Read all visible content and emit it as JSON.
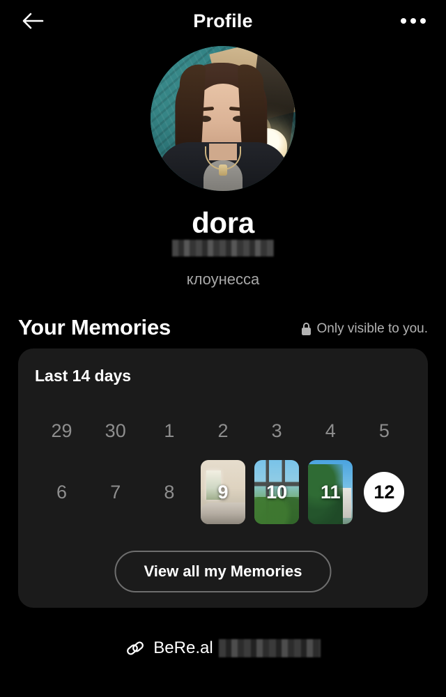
{
  "header": {
    "title": "Profile",
    "back_icon": "arrow-left-icon",
    "menu_icon": "more-horizontal-icon"
  },
  "profile": {
    "avatar_alt": "user-avatar-photo",
    "display_name": "dora",
    "username": "",
    "username_redacted": true,
    "bio": "клоунесса"
  },
  "memories": {
    "section_title": "Your Memories",
    "visibility_icon": "lock-icon",
    "visibility_text": "Only visible to you.",
    "card_title": "Last 14 days",
    "days": [
      {
        "label": "29",
        "state": "empty"
      },
      {
        "label": "30",
        "state": "empty"
      },
      {
        "label": "1",
        "state": "empty"
      },
      {
        "label": "2",
        "state": "empty"
      },
      {
        "label": "3",
        "state": "empty"
      },
      {
        "label": "4",
        "state": "empty"
      },
      {
        "label": "5",
        "state": "empty"
      },
      {
        "label": "6",
        "state": "empty"
      },
      {
        "label": "7",
        "state": "empty"
      },
      {
        "label": "8",
        "state": "empty"
      },
      {
        "label": "9",
        "state": "photo",
        "thumb": "bedroom"
      },
      {
        "label": "10",
        "state": "photo",
        "thumb": "window"
      },
      {
        "label": "11",
        "state": "photo",
        "thumb": "tree"
      },
      {
        "label": "12",
        "state": "today"
      }
    ],
    "view_all_label": "View all my Memories"
  },
  "profile_link": {
    "icon": "link-icon",
    "text": "BeRe.al",
    "suffix_redacted": true
  },
  "colors": {
    "background": "#000000",
    "card": "#1b1b1b",
    "primary_text": "#ffffff",
    "muted_text": "#8e8e8e",
    "secondary_text": "#b3b3b3",
    "today_chip": "#ffffff",
    "button_border": "#6e6e6e"
  }
}
